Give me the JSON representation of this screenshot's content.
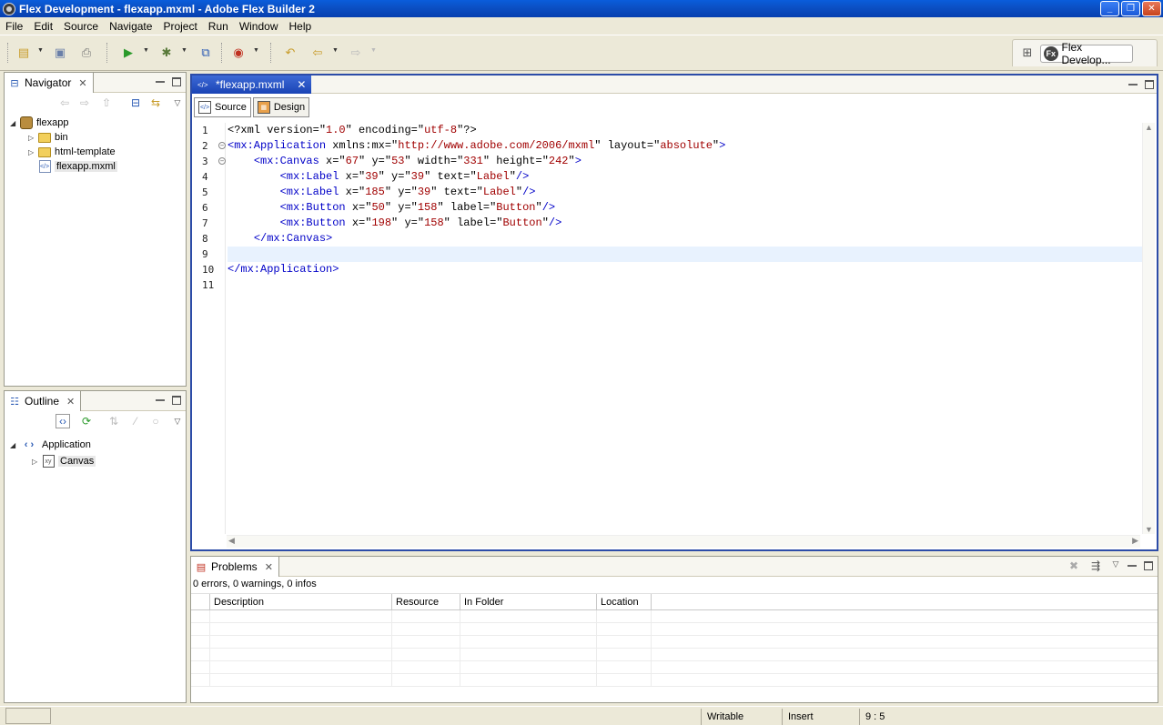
{
  "window": {
    "title": "Flex Development - flexapp.mxml - Adobe Flex Builder 2"
  },
  "menu": [
    "File",
    "Edit",
    "Source",
    "Navigate",
    "Project",
    "Run",
    "Window",
    "Help"
  ],
  "perspective": {
    "label": "Flex Develop..."
  },
  "navigator": {
    "tab": "Navigator",
    "tree": {
      "project": "flexapp",
      "children": [
        "bin",
        "html-template",
        "flexapp.mxml"
      ]
    }
  },
  "outline": {
    "tab": "Outline",
    "tree": {
      "root": "Application",
      "child": "Canvas"
    }
  },
  "editor": {
    "tab": "*flexapp.mxml",
    "modes": {
      "source": "Source",
      "design": "Design"
    },
    "lines": [
      "<?xml version=\"1.0\" encoding=\"utf-8\"?>",
      "<mx:Application xmlns:mx=\"http://www.adobe.com/2006/mxml\" layout=\"absolute\">",
      "    <mx:Canvas x=\"67\" y=\"53\" width=\"331\" height=\"242\">",
      "        <mx:Label x=\"39\" y=\"39\" text=\"Label\"/>",
      "        <mx:Label x=\"185\" y=\"39\" text=\"Label\"/>",
      "        <mx:Button x=\"50\" y=\"158\" label=\"Button\"/>",
      "        <mx:Button x=\"198\" y=\"158\" label=\"Button\"/>",
      "    </mx:Canvas>",
      "",
      "</mx:Application>",
      ""
    ],
    "current_line": 9
  },
  "problems": {
    "tab": "Problems",
    "summary": "0 errors, 0 warnings, 0 infos",
    "columns": [
      "Description",
      "Resource",
      "In Folder",
      "Location"
    ]
  },
  "status": {
    "writable": "Writable",
    "insert": "Insert",
    "position": "9 : 5"
  },
  "colors": {
    "accent": "#2c4ca8",
    "tag": "#0000c8",
    "value": "#a00000"
  }
}
